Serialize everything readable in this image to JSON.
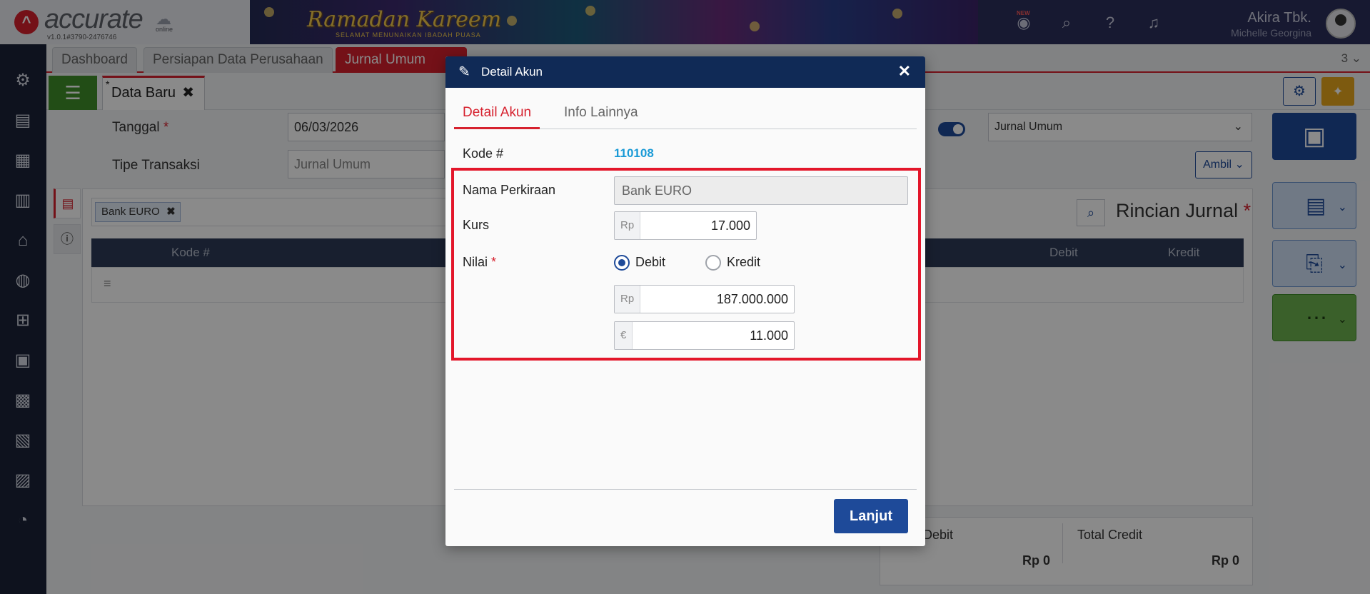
{
  "app": {
    "logo_text": "accurate",
    "logo_sub": "online",
    "version": "v1.0.1#3790-2476746",
    "banner_title": "Ramadan Kareem",
    "banner_sub": "SELAMAT MENUNAIKAN IBADAH PUASA",
    "new_badge": "NEW",
    "company": "Akira Tbk.",
    "user": "Michelle Georgina"
  },
  "tabs": {
    "items": [
      "Dashboard",
      "Persiapan Data Perusahaan",
      "Jurnal Umum"
    ],
    "count": "3 ⌄"
  },
  "subtab": {
    "star": "*",
    "label": "Data Baru"
  },
  "form": {
    "tanggal_label": "Tanggal",
    "tanggal_value": "06/03/2026",
    "tipe_label": "Tipe Transaksi",
    "tipe_placeholder": "Jurnal Umum",
    "select_value": "Jurnal Umum",
    "ambil_label": "Ambil ⌄",
    "chip": "Bank EURO",
    "rincian": "Rincian Jurnal",
    "columns": {
      "kode": "Kode #",
      "debit": "Debit",
      "kredit": "Kredit"
    },
    "totals": {
      "debit_label": "Debit",
      "debit_value": "Rp 0",
      "credit_label": "Total Credit",
      "credit_value": "Rp 0"
    }
  },
  "modal": {
    "title": "Detail Akun",
    "tabs": [
      "Detail Akun",
      "Info Lainnya"
    ],
    "kode_label": "Kode #",
    "kode_value": "110108",
    "nama_label": "Nama Perkiraan",
    "nama_value": "Bank EURO",
    "kurs_label": "Kurs",
    "kurs_currency": "Rp",
    "kurs_value": "17.000",
    "nilai_label": "Nilai",
    "radio_debit": "Debit",
    "radio_kredit": "Kredit",
    "selected": "Debit",
    "amount_idr_currency": "Rp",
    "amount_idr": "187.000.000",
    "amount_eur_currency": "€",
    "amount_eur": "11.000",
    "submit_label": "Lanjut"
  }
}
